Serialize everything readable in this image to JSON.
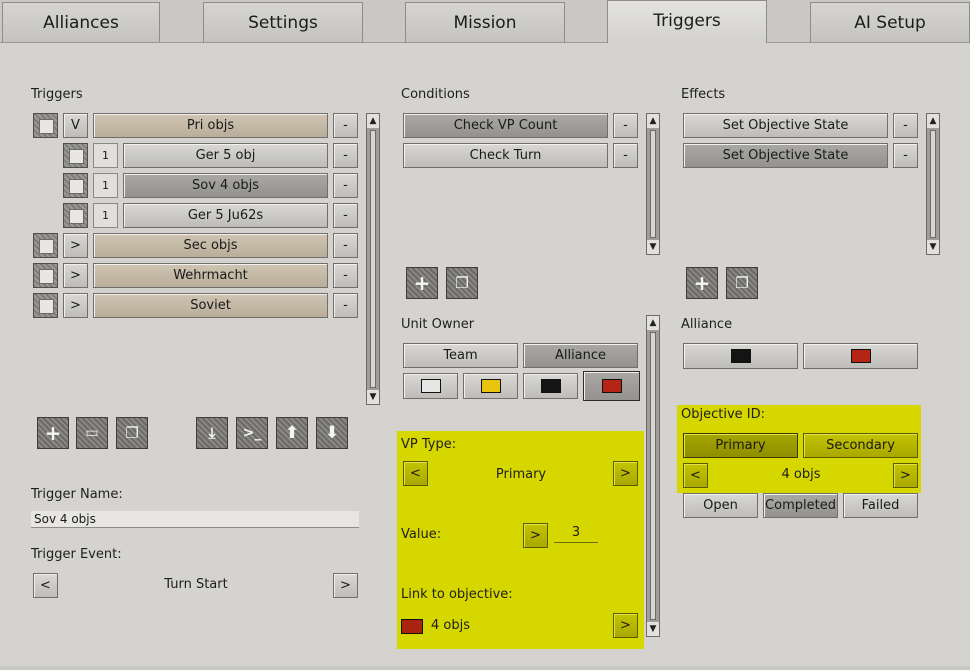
{
  "tabs": [
    "Alliances",
    "Settings",
    "Mission",
    "Triggers",
    "AI Setup"
  ],
  "triggers": {
    "heading": "Triggers",
    "rows": [
      {
        "toggle": "V",
        "label": "Pri objs"
      },
      {
        "num": "1",
        "label": "Ger 5 obj"
      },
      {
        "num": "1",
        "label": "Sov 4 objs"
      },
      {
        "num": "1",
        "label": "Ger 5 Ju62s"
      },
      {
        "toggle": ">",
        "label": "Sec objs"
      },
      {
        "toggle": ">",
        "label": "Wehrmacht"
      },
      {
        "toggle": ">",
        "label": "Soviet"
      }
    ],
    "remove_label": "-"
  },
  "conditions": {
    "heading": "Conditions",
    "items": [
      "Check VP Count",
      "Check Turn"
    ]
  },
  "effects": {
    "heading": "Effects",
    "items": [
      "Set Objective State",
      "Set Objective State"
    ]
  },
  "unit_owner": {
    "heading": "Unit Owner",
    "team_label": "Team",
    "alliance_label": "Alliance",
    "colors": [
      "#e6e6e6",
      "#e8c40c",
      "#141414",
      "#b52415"
    ]
  },
  "vp": {
    "type_label": "VP Type:",
    "type_value": "Primary",
    "value_label": "Value:",
    "value": "3",
    "link_label": "Link to objective:",
    "link_value": "4 objs",
    "link_color": "#a8240f"
  },
  "alliance": {
    "heading": "Alliance",
    "colors": [
      "#141414",
      "#b52415"
    ]
  },
  "objective": {
    "heading": "Objective ID:",
    "primary_label": "Primary",
    "secondary_label": "Secondary",
    "value": "4 objs",
    "states": [
      "Open",
      "Completed",
      "Failed"
    ]
  },
  "trigger_name": {
    "label": "Trigger Name:",
    "value": "Sov 4 objs"
  },
  "trigger_event": {
    "label": "Trigger Event:",
    "value": "Turn Start"
  },
  "nav": {
    "prev": "<",
    "next": ">"
  }
}
